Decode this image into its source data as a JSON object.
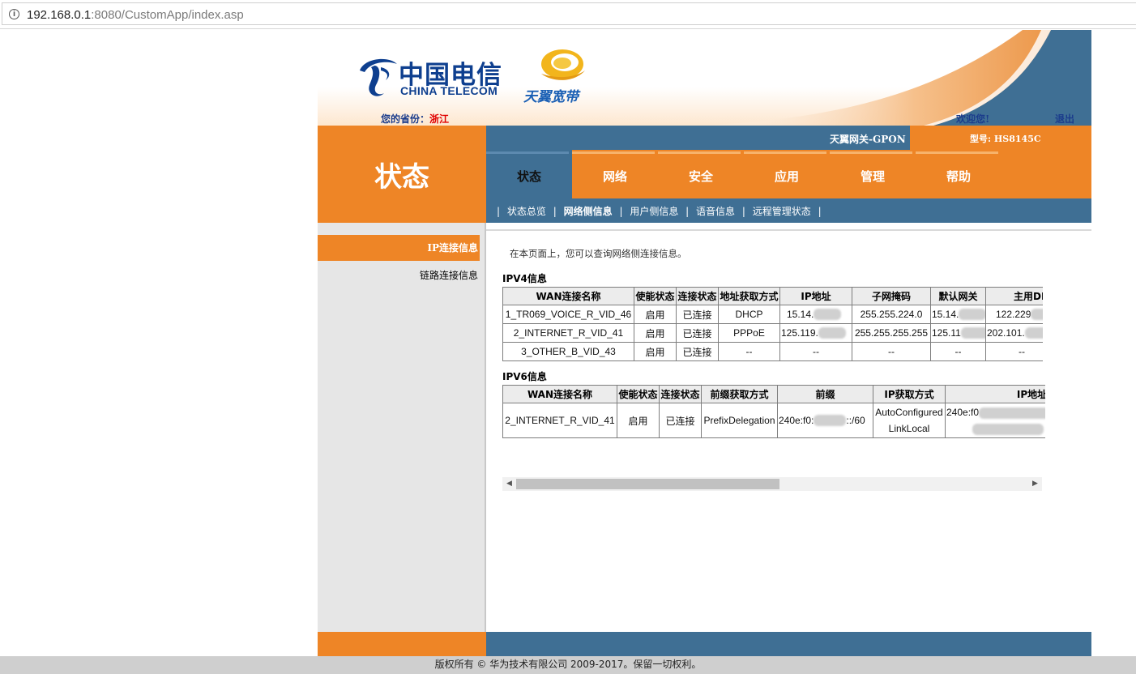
{
  "browser": {
    "url_host": "192.168.0.1",
    "url_rest": ":8080/CustomApp/index.asp",
    "info_icon": "info-icon"
  },
  "header": {
    "brand_cn": "中国电信",
    "brand_en": "CHINA TELECOM",
    "sub_brand": "天翼宽带",
    "province_label": "您的省份：",
    "province_value": "浙江",
    "welcome": "欢迎您!",
    "logout": "退出",
    "gateway": "天翼网关-GPON",
    "model": "型号: HS8145C"
  },
  "section_title": "状态",
  "nav": {
    "tabs": [
      "状态",
      "网络",
      "安全",
      "应用",
      "管理",
      "帮助"
    ],
    "active": 0
  },
  "subnav": {
    "items": [
      "状态总览",
      "网络侧信息",
      "用户侧信息",
      "语音信息",
      "远程管理状态"
    ],
    "active": 1
  },
  "leftmenu": {
    "items": [
      "IP连接信息",
      "链路连接信息"
    ],
    "active": 0
  },
  "content": {
    "description": "在本页面上，您可以查询网络侧连接信息。",
    "ipv4_title": "IPV4信息",
    "ipv4_headers": [
      "WAN连接名称",
      "使能状态",
      "连接状态",
      "地址获取方式",
      "IP地址",
      "子网掩码",
      "默认网关",
      "主用DNS"
    ],
    "ipv4_rows": [
      [
        "1_TR069_VOICE_R_VID_46",
        "启用",
        "已连接",
        "DHCP",
        "15.14.",
        "255.255.224.0",
        "15.14.",
        "122.229"
      ],
      [
        "2_INTERNET_R_VID_41",
        "启用",
        "已连接",
        "PPPoE",
        "125.119.",
        "255.255.255.255",
        "125.11",
        "202.101."
      ],
      [
        "3_OTHER_B_VID_43",
        "启用",
        "已连接",
        "--",
        "--",
        "--",
        "--",
        "--"
      ]
    ],
    "ipv6_title": "IPV6信息",
    "ipv6_headers": [
      "WAN连接名称",
      "使能状态",
      "连接状态",
      "前缀获取方式",
      "前缀",
      "IP获取方式",
      "IP地址"
    ],
    "ipv6_rows": [
      [
        "2_INTERNET_R_VID_41",
        "启用",
        "已连接",
        "PrefixDelegation",
        "240e:f0:",
        "::/60",
        "AutoConfigured",
        "LinkLocal",
        "240e:f0"
      ]
    ]
  },
  "footer": {
    "copyright": "版权所有 © 华为技术有限公司 2009-2017。保留一切权利。"
  },
  "colors": {
    "orange": "#ee8526",
    "blue": "#3f6f94",
    "brand_blue": "#0e3f8f"
  }
}
